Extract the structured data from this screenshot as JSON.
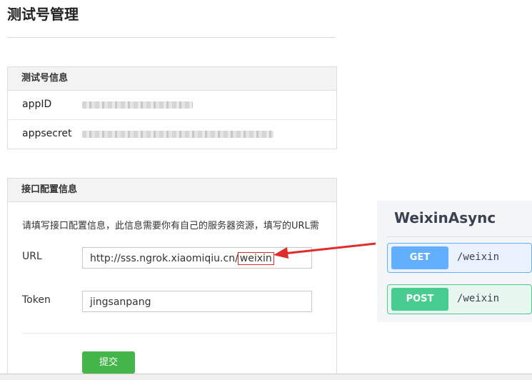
{
  "page": {
    "title": "测试号管理"
  },
  "test_account": {
    "header": "测试号信息",
    "rows": [
      {
        "label": "appID"
      },
      {
        "label": "appsecret"
      }
    ]
  },
  "interface_config": {
    "header": "接口配置信息",
    "description": "请填写接口配置信息，此信息需要你有自己的服务器资源，填写的URL需",
    "url_label": "URL",
    "url_value_prefix": "http://sss.ngrok.xiaomiqiu.cn/",
    "url_value_highlight": "weixin",
    "token_label": "Token",
    "token_value": "jingsanpang",
    "submit_label": "提交"
  },
  "api_doc": {
    "title": "WeixinAsync",
    "operations": [
      {
        "method": "GET",
        "path": "/weixin"
      },
      {
        "method": "POST",
        "path": "/weixin"
      }
    ]
  },
  "colors": {
    "submit": "#44b549",
    "get": "#61affe",
    "post": "#49cc90",
    "highlight": "#e02b2b"
  }
}
